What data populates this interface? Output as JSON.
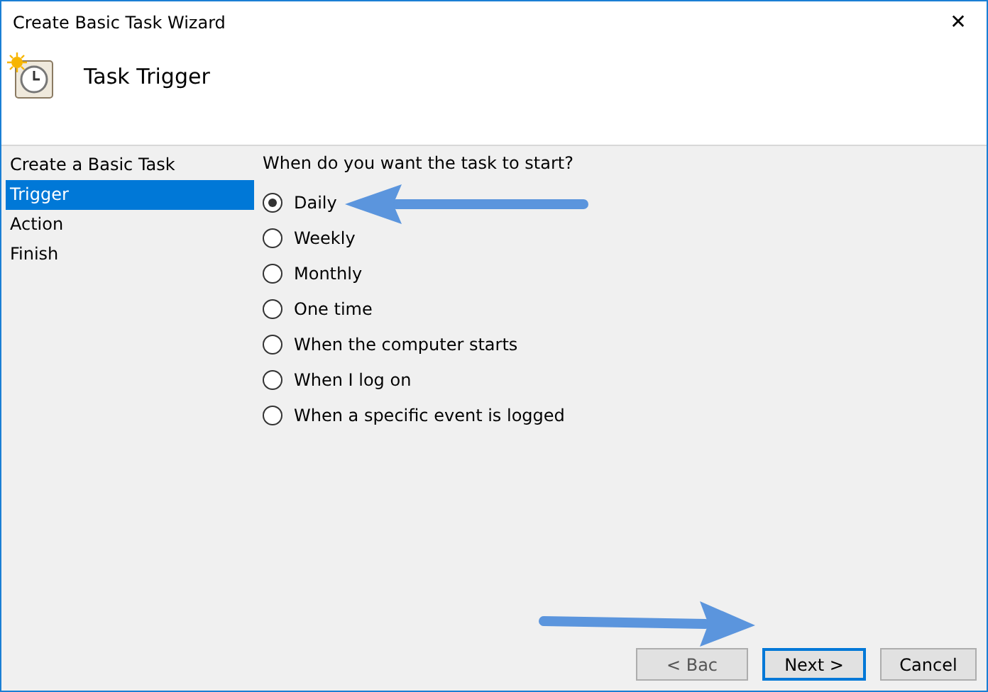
{
  "window": {
    "title": "Create Basic Task Wizard",
    "close": "✕"
  },
  "header": {
    "title": "Task Trigger"
  },
  "sidebar": {
    "items": [
      {
        "label": "Create a Basic Task",
        "selected": false
      },
      {
        "label": "Trigger",
        "selected": true
      },
      {
        "label": "Action",
        "selected": false
      },
      {
        "label": "Finish",
        "selected": false
      }
    ]
  },
  "question": "When do you want the task to start?",
  "options": [
    {
      "label": "Daily",
      "selected": true
    },
    {
      "label": "Weekly",
      "selected": false
    },
    {
      "label": "Monthly",
      "selected": false
    },
    {
      "label": "One time",
      "selected": false
    },
    {
      "label": "When the computer starts",
      "selected": false
    },
    {
      "label": "When I log on",
      "selected": false
    },
    {
      "label": "When a specific event is logged",
      "selected": false
    }
  ],
  "buttons": [
    {
      "label": "< Bac",
      "kind": "back"
    },
    {
      "label": "Next >",
      "kind": "default"
    },
    {
      "label": "Cancel",
      "kind": "normal"
    }
  ]
}
